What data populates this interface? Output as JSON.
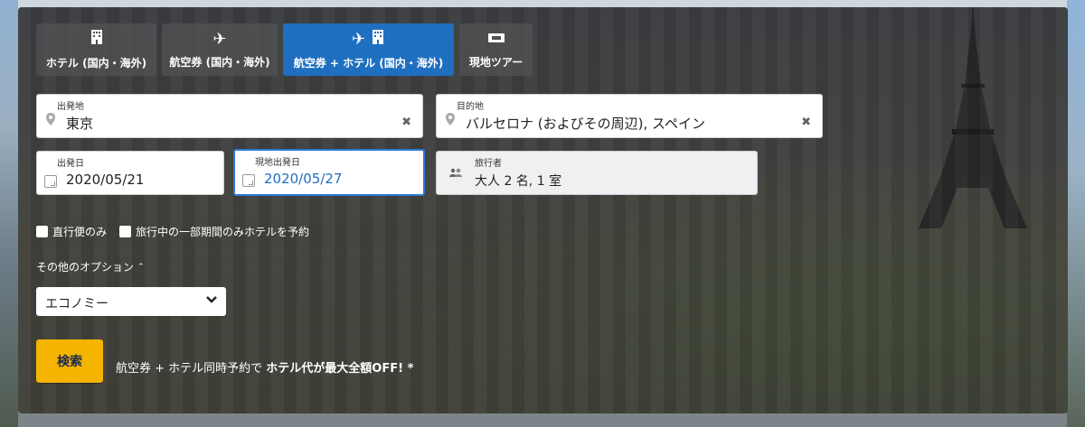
{
  "tabs": [
    {
      "label": "ホテル (国内・海外)",
      "icon": "hotel-icon"
    },
    {
      "label": "航空券 (国内・海外)",
      "icon": "airplane-icon"
    },
    {
      "label": "航空券 + ホテル (国内・海外)",
      "icon": "airplane-hotel-icon"
    },
    {
      "label": "現地ツアー",
      "icon": "ticket-icon"
    }
  ],
  "origin": {
    "label": "出発地",
    "value": "東京"
  },
  "destination": {
    "label": "目的地",
    "value": "バルセロナ (およびその周辺), スペイン"
  },
  "depart": {
    "label": "出発日",
    "value": "2020/05/21"
  },
  "return": {
    "label": "現地出発日",
    "value": "2020/05/27"
  },
  "travelers": {
    "label": "旅行者",
    "value": "大人 2 名, 1 室"
  },
  "checkboxes": [
    {
      "label": "直行便のみ"
    },
    {
      "label": "旅行中の一部期間のみホテルを予約"
    }
  ],
  "more_options": "その他のオプション",
  "cabin_class": "エコノミー",
  "search_label": "検索",
  "promo": {
    "text": "航空券 + ホテル同時予約で ",
    "bold": "ホテル代が最大全額OFF! *"
  },
  "colors": {
    "accent": "#1f6fc1",
    "search_button": "#f4b400"
  }
}
